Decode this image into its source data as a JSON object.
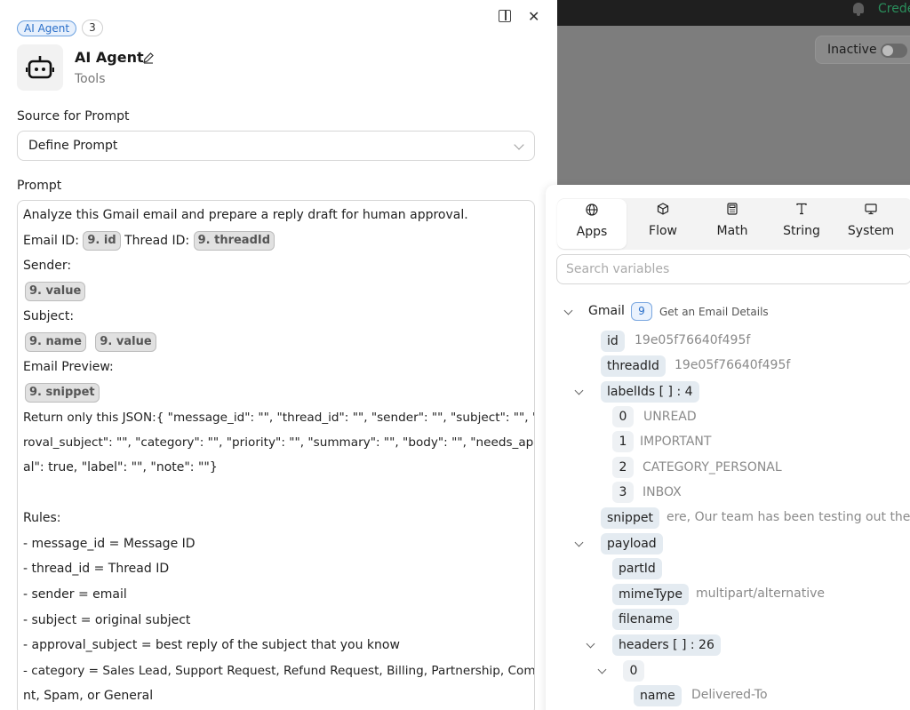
{
  "background": {
    "header_text": "Crede",
    "status_label": "Inactive"
  },
  "panel": {
    "badge": "AI Agent",
    "badge_count": "3",
    "title": "AI Agent",
    "subtitle": "Tools",
    "source_label": "Source for Prompt",
    "source_value": "Define Prompt",
    "prompt_label": "Prompt",
    "prompt": {
      "l1": "Analyze this Gmail email and prepare a reply draft for human approval.",
      "email_id_label": "Email ID:",
      "email_id_chip": "9. id",
      "thread_id_label": "Thread ID:",
      "thread_id_chip": "9. threadId",
      "sender_label": "Sender:",
      "sender_chip": "9. value",
      "subject_label": "Subject:",
      "subject_chip1": "9. name",
      "subject_chip2": "9. value",
      "preview_label": "Email Preview:",
      "preview_chip": "9. snippet",
      "json1": "Return only this JSON:{ \"message_id\": \"\", \"thread_id\": \"\", \"sender\": \"\", \"subject\": \"\", \"app",
      "json2": "roval_subject\": \"\", \"category\": \"\", \"priority\": \"\", \"summary\": \"\", \"body\": \"\", \"needs_approv",
      "json3": "al\": true, \"label\": \"\", \"note\": \"\"}",
      "rules": "Rules:",
      "r1": "- message_id = Message ID",
      "r2": "- thread_id = Thread ID",
      "r3": "- sender = email",
      "r4": "- subject = original subject",
      "r5": "- approval_subject =  best reply of the subject that you know",
      "r6a": "- category = Sales Lead, Support Request, Refund Request, Billing, Partnership, Complai",
      "r6b": "nt, Spam, or General"
    }
  },
  "variables": {
    "tabs": [
      "Apps",
      "Flow",
      "Math",
      "String",
      "System"
    ],
    "search_placeholder": "Search variables",
    "gmail": {
      "label": "Gmail",
      "num": "9",
      "desc": "Get an Email Details",
      "id_key": "id",
      "id_val": "19e05f76640f495f",
      "thread_key": "threadId",
      "thread_val": "19e05f76640f495f",
      "labels_key": "labelIds [ ] : 4",
      "labels": [
        {
          "i": "0",
          "v": "UNREAD"
        },
        {
          "i": "1",
          "v": "IMPORTANT"
        },
        {
          "i": "2",
          "v": "CATEGORY_PERSONAL"
        },
        {
          "i": "3",
          "v": "INBOX"
        }
      ],
      "snippet_key": "snippet",
      "snippet_val": "ere, Our team has been testing out the fre",
      "payload_key": "payload",
      "partid_key": "partId",
      "mime_key": "mimeType",
      "mime_val": "multipart/alternative",
      "filename_key": "filename",
      "headers_key": "headers [ ] : 26",
      "h0_key": "0",
      "name_key": "name",
      "name_val": "Delivered-To"
    }
  }
}
